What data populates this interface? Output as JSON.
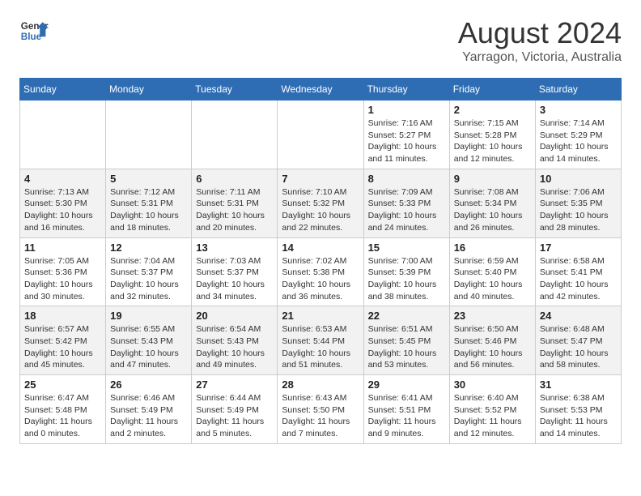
{
  "header": {
    "logo_line1": "General",
    "logo_line2": "Blue",
    "month_year": "August 2024",
    "location": "Yarragon, Victoria, Australia"
  },
  "weekdays": [
    "Sunday",
    "Monday",
    "Tuesday",
    "Wednesday",
    "Thursday",
    "Friday",
    "Saturday"
  ],
  "weeks": [
    [
      {
        "day": "",
        "info": ""
      },
      {
        "day": "",
        "info": ""
      },
      {
        "day": "",
        "info": ""
      },
      {
        "day": "",
        "info": ""
      },
      {
        "day": "1",
        "info": "Sunrise: 7:16 AM\nSunset: 5:27 PM\nDaylight: 10 hours\nand 11 minutes."
      },
      {
        "day": "2",
        "info": "Sunrise: 7:15 AM\nSunset: 5:28 PM\nDaylight: 10 hours\nand 12 minutes."
      },
      {
        "day": "3",
        "info": "Sunrise: 7:14 AM\nSunset: 5:29 PM\nDaylight: 10 hours\nand 14 minutes."
      }
    ],
    [
      {
        "day": "4",
        "info": "Sunrise: 7:13 AM\nSunset: 5:30 PM\nDaylight: 10 hours\nand 16 minutes."
      },
      {
        "day": "5",
        "info": "Sunrise: 7:12 AM\nSunset: 5:31 PM\nDaylight: 10 hours\nand 18 minutes."
      },
      {
        "day": "6",
        "info": "Sunrise: 7:11 AM\nSunset: 5:31 PM\nDaylight: 10 hours\nand 20 minutes."
      },
      {
        "day": "7",
        "info": "Sunrise: 7:10 AM\nSunset: 5:32 PM\nDaylight: 10 hours\nand 22 minutes."
      },
      {
        "day": "8",
        "info": "Sunrise: 7:09 AM\nSunset: 5:33 PM\nDaylight: 10 hours\nand 24 minutes."
      },
      {
        "day": "9",
        "info": "Sunrise: 7:08 AM\nSunset: 5:34 PM\nDaylight: 10 hours\nand 26 minutes."
      },
      {
        "day": "10",
        "info": "Sunrise: 7:06 AM\nSunset: 5:35 PM\nDaylight: 10 hours\nand 28 minutes."
      }
    ],
    [
      {
        "day": "11",
        "info": "Sunrise: 7:05 AM\nSunset: 5:36 PM\nDaylight: 10 hours\nand 30 minutes."
      },
      {
        "day": "12",
        "info": "Sunrise: 7:04 AM\nSunset: 5:37 PM\nDaylight: 10 hours\nand 32 minutes."
      },
      {
        "day": "13",
        "info": "Sunrise: 7:03 AM\nSunset: 5:37 PM\nDaylight: 10 hours\nand 34 minutes."
      },
      {
        "day": "14",
        "info": "Sunrise: 7:02 AM\nSunset: 5:38 PM\nDaylight: 10 hours\nand 36 minutes."
      },
      {
        "day": "15",
        "info": "Sunrise: 7:00 AM\nSunset: 5:39 PM\nDaylight: 10 hours\nand 38 minutes."
      },
      {
        "day": "16",
        "info": "Sunrise: 6:59 AM\nSunset: 5:40 PM\nDaylight: 10 hours\nand 40 minutes."
      },
      {
        "day": "17",
        "info": "Sunrise: 6:58 AM\nSunset: 5:41 PM\nDaylight: 10 hours\nand 42 minutes."
      }
    ],
    [
      {
        "day": "18",
        "info": "Sunrise: 6:57 AM\nSunset: 5:42 PM\nDaylight: 10 hours\nand 45 minutes."
      },
      {
        "day": "19",
        "info": "Sunrise: 6:55 AM\nSunset: 5:43 PM\nDaylight: 10 hours\nand 47 minutes."
      },
      {
        "day": "20",
        "info": "Sunrise: 6:54 AM\nSunset: 5:43 PM\nDaylight: 10 hours\nand 49 minutes."
      },
      {
        "day": "21",
        "info": "Sunrise: 6:53 AM\nSunset: 5:44 PM\nDaylight: 10 hours\nand 51 minutes."
      },
      {
        "day": "22",
        "info": "Sunrise: 6:51 AM\nSunset: 5:45 PM\nDaylight: 10 hours\nand 53 minutes."
      },
      {
        "day": "23",
        "info": "Sunrise: 6:50 AM\nSunset: 5:46 PM\nDaylight: 10 hours\nand 56 minutes."
      },
      {
        "day": "24",
        "info": "Sunrise: 6:48 AM\nSunset: 5:47 PM\nDaylight: 10 hours\nand 58 minutes."
      }
    ],
    [
      {
        "day": "25",
        "info": "Sunrise: 6:47 AM\nSunset: 5:48 PM\nDaylight: 11 hours\nand 0 minutes."
      },
      {
        "day": "26",
        "info": "Sunrise: 6:46 AM\nSunset: 5:49 PM\nDaylight: 11 hours\nand 2 minutes."
      },
      {
        "day": "27",
        "info": "Sunrise: 6:44 AM\nSunset: 5:49 PM\nDaylight: 11 hours\nand 5 minutes."
      },
      {
        "day": "28",
        "info": "Sunrise: 6:43 AM\nSunset: 5:50 PM\nDaylight: 11 hours\nand 7 minutes."
      },
      {
        "day": "29",
        "info": "Sunrise: 6:41 AM\nSunset: 5:51 PM\nDaylight: 11 hours\nand 9 minutes."
      },
      {
        "day": "30",
        "info": "Sunrise: 6:40 AM\nSunset: 5:52 PM\nDaylight: 11 hours\nand 12 minutes."
      },
      {
        "day": "31",
        "info": "Sunrise: 6:38 AM\nSunset: 5:53 PM\nDaylight: 11 hours\nand 14 minutes."
      }
    ]
  ]
}
